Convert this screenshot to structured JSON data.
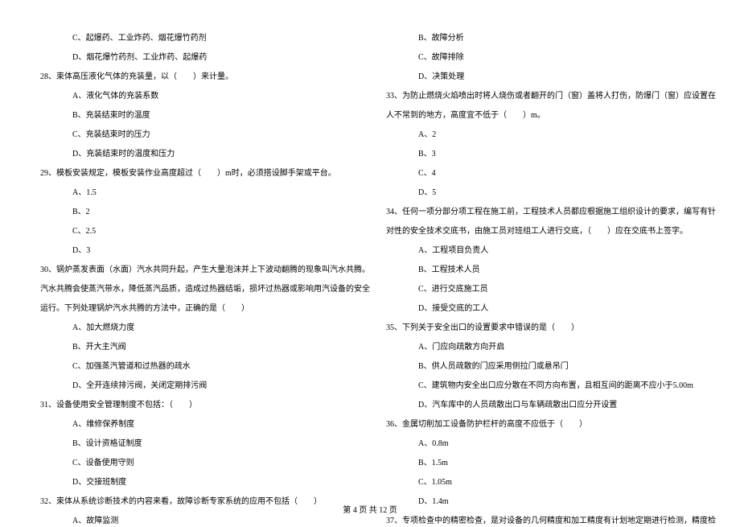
{
  "left": {
    "l1": "C、起爆药、工业炸药、烟花爆竹药剂",
    "l2": "D、烟花爆竹药剂、工业炸药、起爆药",
    "q28": "28、束体高压液化气体的充装量，以（　　）来计量。",
    "q28a": "A、液化气体的充装系数",
    "q28b": "B、充装结束时的温度",
    "q28c": "C、充装结束时的压力",
    "q28d": "D、充装结束时的温度和压力",
    "q29": "29、模板安装规定，模板安装作业高度超过（　　）m时，必须搭设脚手架或平台。",
    "q29a": "A、1.5",
    "q29b": "B、2",
    "q29c": "C、2.5",
    "q29d": "D、3",
    "q30_1": "30、锅炉蒸发表面（水面）汽水共同升起，产生大量泡沫并上下波动翻腾的现象叫汽水共腾。",
    "q30_2": "汽水共腾会使蒸汽带水，降低蒸汽品质，造成过热器结垢，损坏过热器或影响用汽设备的安全",
    "q30_3": "运行。下列处理锅炉汽水共腾的方法中，正确的是（　　）",
    "q30a": "A、加大燃烧力度",
    "q30b": "B、开大主汽阀",
    "q30c": "C、加强蒸汽管道和过热器的疏水",
    "q30d": "D、全开连续排污阀，关闭定期排污阀",
    "q31": "31、设备使用安全管理制度不包括：（　　）",
    "q31a": "A、维修保养制度",
    "q31b": "B、设计资格证制度",
    "q31c": "C、设备使用守则",
    "q31d": "D、交接班制度",
    "q32": "32、束体从系统诊断技术的内容来看，故障诊断专家系统的应用不包括（　　）",
    "q32a": "A、故障监测"
  },
  "right": {
    "r1": "B、故障分析",
    "r2": "C、故障排除",
    "r3": "D、决策处理",
    "q33_1": "33、为防止燃烧火焰喷出时将人烧伤或者翻开的门（窗）盖将人打伤，防爆门（窗）应设置在",
    "q33_2": "人不常到的地方，高度宜不低于（　　）m。",
    "q33a": "A、2",
    "q33b": "B、3",
    "q33c": "C、4",
    "q33d": "D、5",
    "q34_1": "34、任何一项分部分项工程在施工前，工程技术人员都应根据施工组织设计的要求，编写有针",
    "q34_2": "对性的安全技术交底书，由施工员对班组工人进行交底，（　　）应在交底书上签字。",
    "q34a": "A、工程项目负责人",
    "q34b": "B、工程技术人员",
    "q34c": "C、进行交底施工员",
    "q34d": "D、接受交底的工人",
    "q35": "35、下列关于安全出口的设置要求中错误的是（　　）",
    "q35a": "A、门应向疏散方向开启",
    "q35b": "B、供人员疏散的门应采用侧拉门或悬吊门",
    "q35c": "C、建筑物内安全出口应分散在不同方向布置，且相互间的距离不应小于5.00m",
    "q35d": "D、汽车库中的人员疏散出口与车辆疏散出口应分开设置",
    "q36": "36、金属切削加工设备防护栏杆的高度不应低于（　　）",
    "q36a": "A、0.8m",
    "q36b": "B、1.5m",
    "q36c": "C、1.05m",
    "q36d": "D、1.4m",
    "q37": "37、专项检查中的精密检查，是对设备的几何精度和加工精度有计划地定期进行检测，精度检"
  },
  "footer": "第 4 页 共 12 页"
}
